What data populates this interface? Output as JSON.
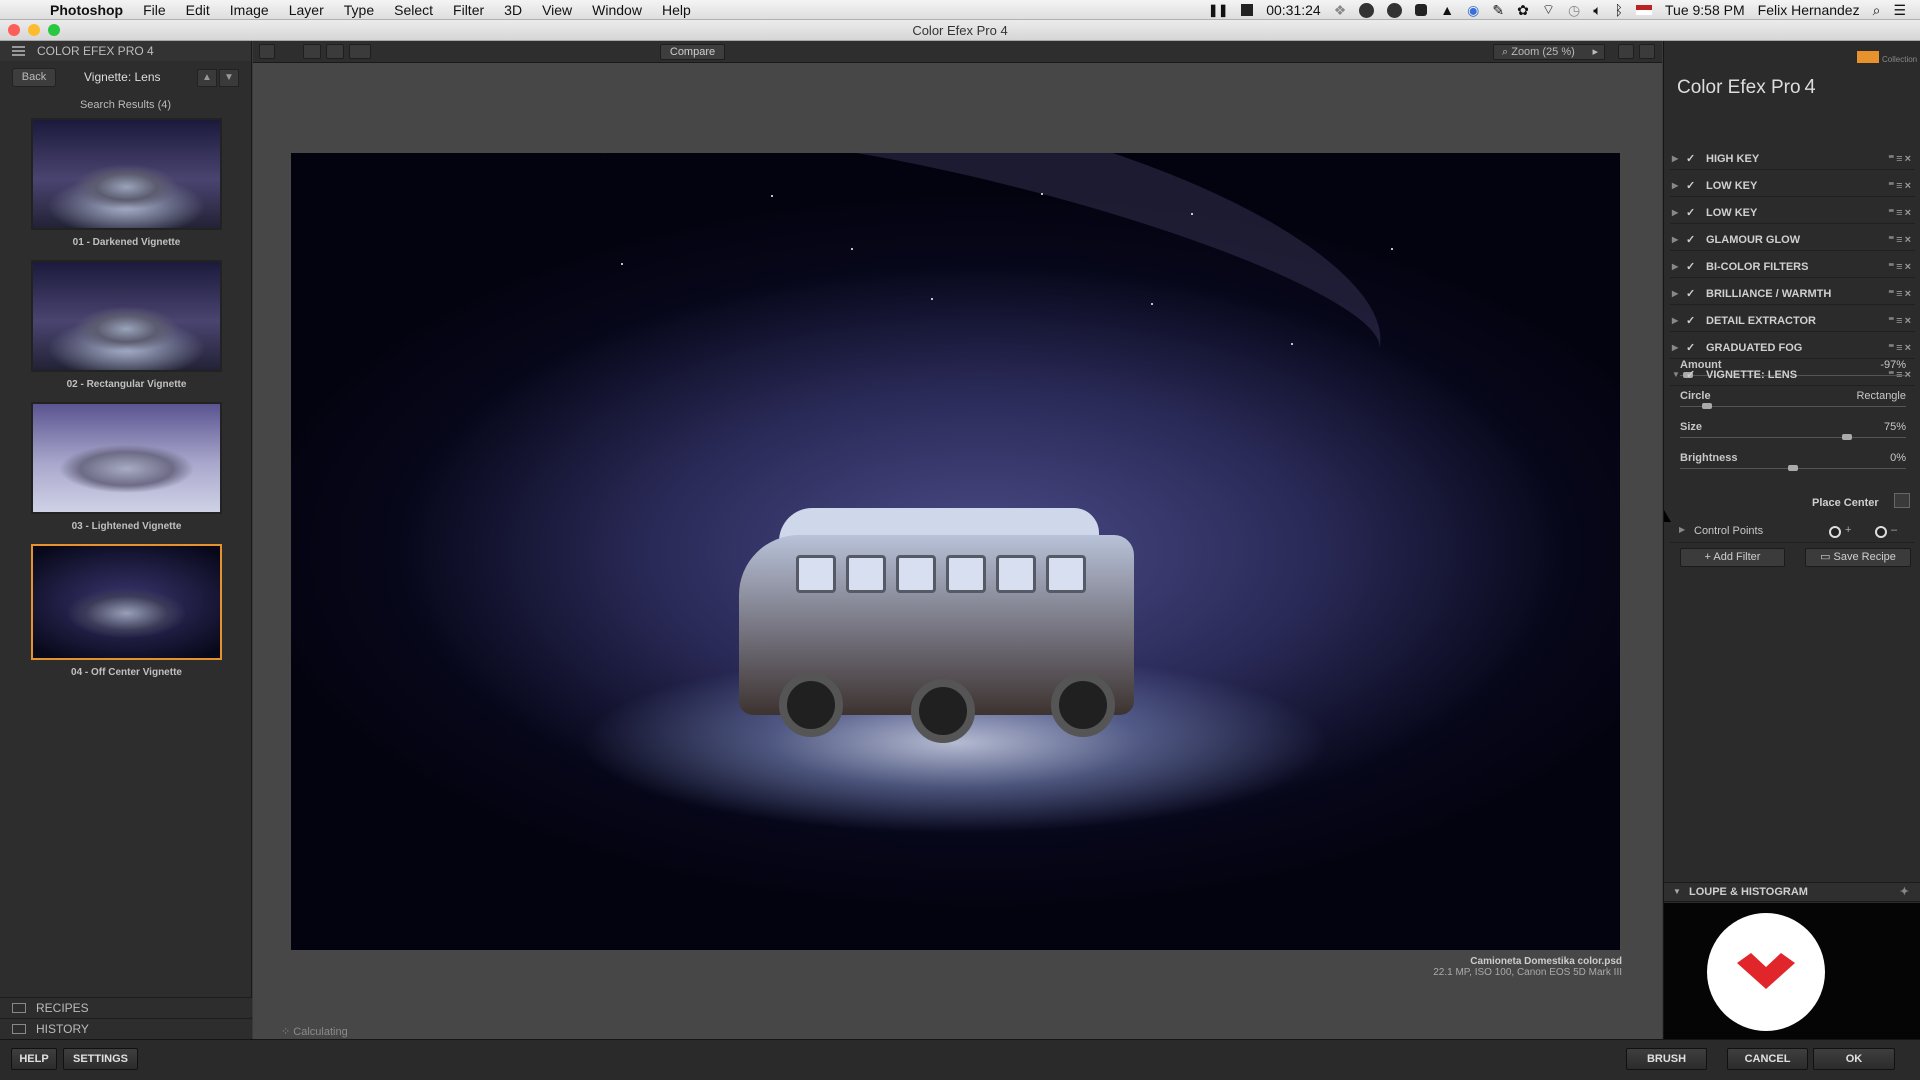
{
  "menubar": {
    "app": "Photoshop",
    "menus": [
      "File",
      "Edit",
      "Image",
      "Layer",
      "Type",
      "Select",
      "Filter",
      "3D",
      "View",
      "Window",
      "Help"
    ],
    "timer": "00:31:24",
    "clock": "Tue 9:58 PM",
    "user": "Felix Hernandez"
  },
  "window": {
    "title": "Color Efex Pro 4"
  },
  "left_panel": {
    "header": "COLOR EFEX PRO 4",
    "back": "Back",
    "current_filter": "Vignette: Lens",
    "search_results": "Search Results (4)",
    "presets": [
      {
        "label": "01 - Darkened Vignette"
      },
      {
        "label": "02 - Rectangular Vignette"
      },
      {
        "label": "03 - Lightened Vignette"
      },
      {
        "label": "04 - Off Center Vignette"
      }
    ],
    "selected_preset": 3,
    "recipes": "RECIPES",
    "history": "HISTORY"
  },
  "toolbar": {
    "compare": "Compare",
    "zoom": "Zoom (25 %)"
  },
  "canvas": {
    "file_name": "Camioneta Domestika color.psd",
    "file_info": "22.1 MP, ISO 100, Canon EOS 5D Mark III",
    "status": "Calculating"
  },
  "right_panel": {
    "title": "Color Efex Pro",
    "version": "4",
    "brand_label": "Collection",
    "filters": [
      {
        "name": "HIGH KEY",
        "expanded": false
      },
      {
        "name": "LOW KEY",
        "expanded": false
      },
      {
        "name": "LOW KEY",
        "expanded": false
      },
      {
        "name": "GLAMOUR GLOW",
        "expanded": false
      },
      {
        "name": "BI-COLOR FILTERS",
        "expanded": false
      },
      {
        "name": "BRILLIANCE / WARMTH",
        "expanded": false
      },
      {
        "name": "DETAIL EXTRACTOR",
        "expanded": false
      },
      {
        "name": "GRADUATED FOG",
        "expanded": false
      },
      {
        "name": "VIGNETTE: LENS",
        "expanded": true
      }
    ],
    "params": [
      {
        "label": "Amount",
        "value": "-97%",
        "level": 0.015
      },
      {
        "label": "Circle",
        "value": "Rectangle",
        "level": 0.1
      },
      {
        "label": "Size",
        "value": "75%",
        "level": 0.75
      },
      {
        "label": "Brightness",
        "value": "0%",
        "level": 0.5
      }
    ],
    "place_center": "Place Center",
    "control_points": "Control Points",
    "add_filter": "Add Filter",
    "save_recipe": "Save Recipe",
    "loupe": "LOUPE & HISTOGRAM"
  },
  "bottom": {
    "help": "HELP",
    "settings": "SETTINGS",
    "brush": "BRUSH",
    "cancel": "CANCEL",
    "ok": "OK"
  },
  "colors": {
    "accent": "#e6922e",
    "panel": "#2b2b2b",
    "canvas": "#474747"
  }
}
